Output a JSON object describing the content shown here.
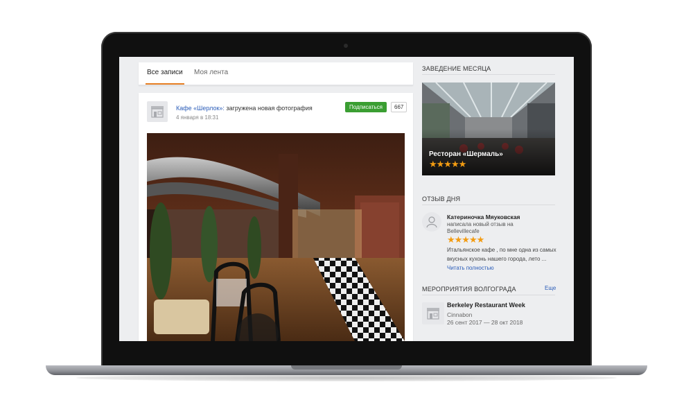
{
  "tabs": [
    {
      "label": "Все записи",
      "active": true
    },
    {
      "label": "Моя лента",
      "active": false
    }
  ],
  "post": {
    "author": "Кафе «Шерлок»:",
    "action": " загружена новая фотография",
    "time": "4 января в 18:31",
    "subscribe_label": "Подписаться",
    "subscribers_count": "667"
  },
  "sidebar": {
    "month": {
      "title": "ЗАВЕДЕНИЕ МЕСЯЦА",
      "name": "Ресторан «Шермаль»",
      "stars": "★★★★★",
      "rating": 4.5
    },
    "review": {
      "title": "ОТЗЫВ ДНЯ",
      "author": "Катериночка Мяуковская",
      "line1": "написала новый отзыв на",
      "place": "Bellevillecafe",
      "stars": "★★★★★",
      "rating": 4.5,
      "text": "Итальянское кафе , по мне одна из самых вкусных кухонь нашего города, лето ...",
      "more_label": "Читать полностью"
    },
    "events": {
      "title": "МЕРОПРИЯТИЯ ВОЛГОГРАДА",
      "more_label": "Еще",
      "items": [
        {
          "name": "Berkeley Restaurant Week",
          "venue": "Cinnabon",
          "dates": "26 сент 2017 — 28 окт 2018"
        }
      ]
    }
  },
  "colors": {
    "accent": "#e67e22",
    "subscribe": "#3a9e32",
    "link": "#2a5cb8",
    "star": "#f39c12"
  },
  "icons": [
    "shop-icon",
    "user-icon",
    "star-icon"
  ]
}
